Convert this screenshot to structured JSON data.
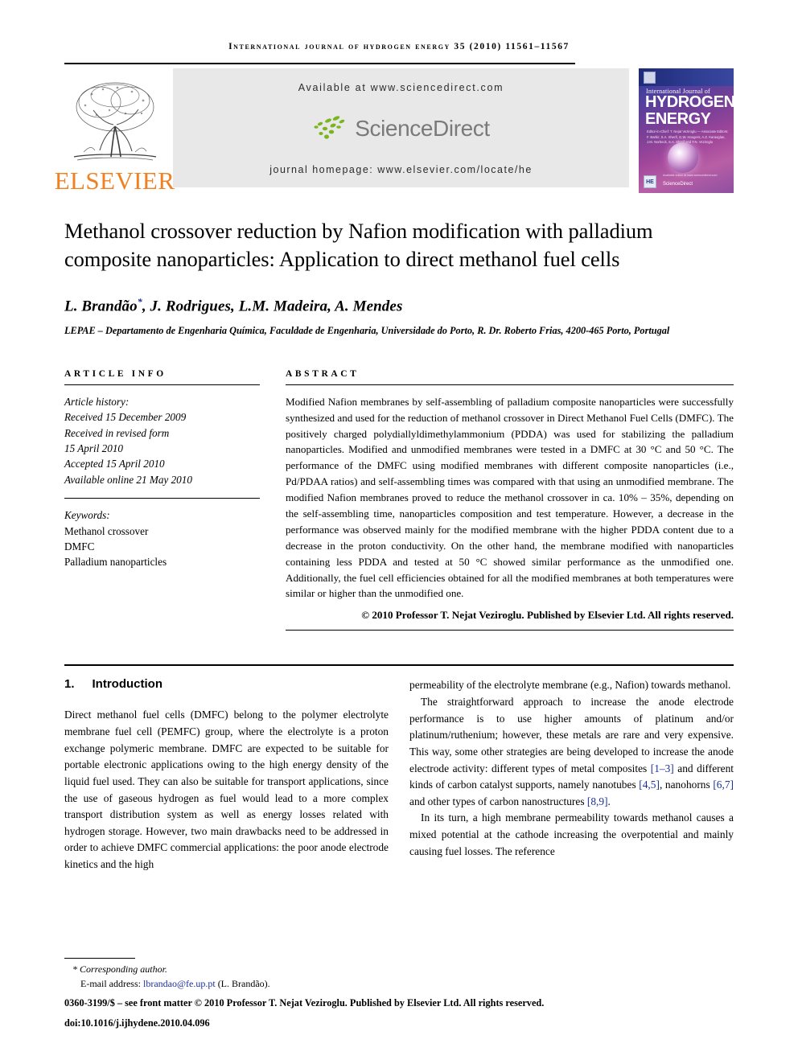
{
  "running_head": "International Journal of Hydrogen Energy 35 (2010) 11561–11567",
  "masthead": {
    "elsevier_word": "ELSEVIER",
    "available_at": "Available at www.sciencedirect.com",
    "sciencedirect_word": "ScienceDirect",
    "journal_homepage": "journal homepage: www.elsevier.com/locate/he",
    "cover": {
      "line_journal_of": "International Journal of",
      "line_hydrogen": "HYDROGEN",
      "line_energy": "ENERGY",
      "editors": "Editor-in-Chief: T. Nejat Veziroglu — Associate Editors: F. Barbir, S.A. Sherif, G.W. Hoogers, A.Z. Karaoglan, J.M. Norbeck, S.A. Sherif and T.N. Veziroglu",
      "he_mark": "HE",
      "sciencedirect_small": "ScienceDirect",
      "available_online": "Available online at www.sciencedirect.com"
    }
  },
  "article": {
    "title": "Methanol crossover reduction by Nafion modification with palladium composite nanoparticles: Application to direct methanol fuel cells",
    "authors": "L. Brandão",
    "authors_rest": ", J. Rodrigues, L.M. Madeira, A. Mendes",
    "corresponding_marker": "*",
    "affiliation": "LEPAE – Departamento de Engenharia Química, Faculdade de Engenharia, Universidade do Porto, R. Dr. Roberto Frias, 4200-465 Porto, Portugal"
  },
  "article_info": {
    "label": "ARTICLE INFO",
    "history_label": "Article history:",
    "history": [
      "Received 15 December 2009",
      "Received in revised form",
      "15 April 2010",
      "Accepted 15 April 2010",
      "Available online 21 May 2010"
    ],
    "keywords_label": "Keywords:",
    "keywords": [
      "Methanol crossover",
      "DMFC",
      "Palladium nanoparticles"
    ]
  },
  "abstract": {
    "label": "ABSTRACT",
    "text": "Modified Nafion membranes by self-assembling of palladium composite nanoparticles were successfully synthesized and used for the reduction of methanol crossover in Direct Methanol Fuel Cells (DMFC). The positively charged polydiallyldimethylammonium (PDDA) was used for stabilizing the palladium nanoparticles. Modified and unmodified membranes were tested in a DMFC at 30 °C and 50 °C. The performance of the DMFC using modified membranes with different composite nanoparticles (i.e., Pd/PDAA ratios) and self-assembling times was compared with that using an unmodified membrane. The modified Nafion membranes proved to reduce the methanol crossover in ca. 10% – 35%, depending on the self-assembling time, nanoparticles composition and test temperature. However, a decrease in the performance was observed mainly for the modified membrane with the higher PDDA content due to a decrease in the proton conductivity. On the other hand, the membrane modified with nanoparticles containing less PDDA and tested at 50 °C showed similar performance as the unmodified one. Additionally, the fuel cell efficiencies obtained for all the modified membranes at both temperatures were similar or higher than the unmodified one.",
    "copyright": "© 2010 Professor T. Nejat Veziroglu. Published by Elsevier Ltd. All rights reserved."
  },
  "introduction": {
    "number": "1.",
    "heading": "Introduction",
    "left_para_1": "Direct methanol fuel cells (DMFC) belong to the polymer electrolyte membrane fuel cell (PEMFC) group, where the electrolyte is a proton exchange polymeric membrane. DMFC are expected to be suitable for portable electronic applications owing to the high energy density of the liquid fuel used. They can also be suitable for transport applications, since the use of gaseous hydrogen as fuel would lead to a more complex transport distribution system as well as energy losses related with hydrogen storage. However, two main drawbacks need to be addressed in order to achieve DMFC commercial applications: the poor anode electrode kinetics and the high",
    "right_para_1": "permeability of the electrolyte membrane (e.g., Nafion) towards methanol.",
    "right_para_2_a": "The straightforward approach to increase the anode electrode performance is to use higher amounts of platinum and/or platinum/ruthenium; however, these metals are rare and very expensive. This way, some other strategies are being developed to increase the anode electrode activity: different types of metal composites ",
    "cite_1": "[1–3]",
    "right_para_2_b": " and different kinds of carbon catalyst supports, namely nanotubes ",
    "cite_2": "[4,5]",
    "right_para_2_c": ", nanohorns ",
    "cite_3": "[6,7]",
    "right_para_2_d": " and other types of carbon nanostructures ",
    "cite_4": "[8,9]",
    "right_para_2_e": ".",
    "right_para_3": "In its turn, a high membrane permeability towards methanol causes a mixed potential at the cathode increasing the overpotential and mainly causing fuel losses. The reference"
  },
  "footer": {
    "corresponding_author": "* Corresponding author.",
    "email_label": "E-mail address: ",
    "email": "lbrandao@fe.up.pt",
    "email_suffix": " (L. Brandão).",
    "issn_line": "0360-3199/$ – see front matter © 2010 Professor T. Nejat Veziroglu. Published by Elsevier Ltd. All rights reserved.",
    "doi_line": "doi:10.1016/j.ijhydene.2010.04.096"
  }
}
